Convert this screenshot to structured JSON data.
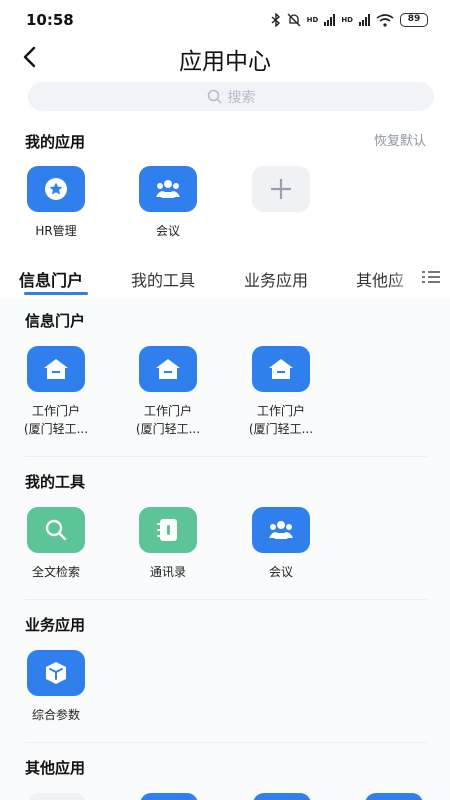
{
  "status": {
    "time": "10:58",
    "battery": "89",
    "hd1": "HD",
    "hd2": "HD"
  },
  "header": {
    "title": "应用中心"
  },
  "search": {
    "placeholder": "搜索"
  },
  "my_apps": {
    "title": "我的应用",
    "restore_label": "恢复默认",
    "items": [
      {
        "label": "HR管理",
        "icon": "star-badge-icon"
      },
      {
        "label": "会议",
        "icon": "people-icon"
      },
      {
        "label": "",
        "icon": "add-icon"
      }
    ]
  },
  "tabs": [
    {
      "label": "信息门户",
      "active": true
    },
    {
      "label": "我的工具"
    },
    {
      "label": "业务应用"
    },
    {
      "label": "其他应"
    }
  ],
  "sections": {
    "portal": {
      "title": "信息门户",
      "items": [
        {
          "line1": "工作门户",
          "line2": "(厦门轻工..."
        },
        {
          "line1": "工作门户",
          "line2": "(厦门轻工..."
        },
        {
          "line1": "工作门户",
          "line2": "(厦门轻工..."
        }
      ]
    },
    "tools": {
      "title": "我的工具",
      "items": [
        {
          "label": "全文检索",
          "icon": "search-icon"
        },
        {
          "label": "通讯录",
          "icon": "contacts-icon"
        },
        {
          "label": "会议",
          "icon": "people-icon"
        }
      ]
    },
    "business": {
      "title": "业务应用",
      "items": [
        {
          "label": "综合参数",
          "icon": "cube-icon"
        }
      ]
    },
    "other": {
      "title": "其他应用"
    }
  },
  "colors": {
    "primary": "#2f80ed",
    "green": "#5cc497",
    "bg": "#fafbfc"
  }
}
